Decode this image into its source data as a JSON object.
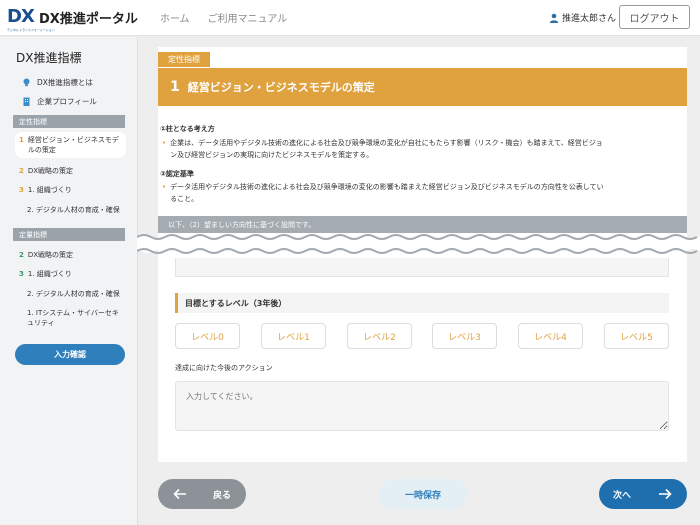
{
  "header": {
    "logo_mark": "DX",
    "logo_sub": "デジタルトランスフォーメーション",
    "app_title": "DX推進ポータル",
    "nav": [
      "ホーム",
      "ご利用マニュアル"
    ],
    "user_name": "推進太郎さん",
    "logout_label": "ログアウト"
  },
  "sidebar": {
    "title": "DX推進指標",
    "links": [
      {
        "icon": "lightbulb-icon",
        "label": "DX推進指標とは"
      },
      {
        "icon": "building-icon",
        "label": "企業プロフィール"
      }
    ],
    "qualitative": {
      "section_label": "定性指標",
      "items": [
        {
          "num": "1",
          "label": "経営ビジョン・ビジネスモデルの策定",
          "line1": "経営ビジョン・ビジネスモデ",
          "line2": "ルの策定",
          "active": true
        },
        {
          "num": "2",
          "label": "DX戦略の策定"
        },
        {
          "num": "3",
          "label": "1. 組織づくり"
        }
      ],
      "subs": [
        "2. デジタル人材の育成・確保"
      ]
    },
    "quantitative": {
      "section_label": "定量指標",
      "items": [
        {
          "num": "2",
          "label": "DX戦略の策定"
        },
        {
          "num": "3",
          "label": "1. 組織づくり"
        }
      ],
      "subs": [
        "2. デジタル人材の育成・確保",
        "1. ITシステム・サイバーセキ",
        "ュリティ"
      ]
    },
    "confirm_label": "入力確認"
  },
  "main": {
    "badge": "定性指標",
    "banner_num": "1",
    "banner_title": "経営ビジョン・ビジネスモデルの策定",
    "basic_heading": "①柱となる考え方",
    "basic_text_1": "企業は、データ活用やデジタル技術の進化による社会及び競争環境の変化が自社にもたらす影響（リスク・機会）も踏まえて、経営ビジョ",
    "basic_text_2": "ン及び経営ビジョンの実現に向けたビジネスモデルを策定する。",
    "cert_heading": "②認定基準",
    "cert_text_1": "データ活用やデジタル技術の進化による社会及び競争環境の変化の影響も踏まえた経営ビジョン及びビジネスモデルの方向性を公表してい",
    "cert_text_2": "ること。",
    "question_bar": "以下、（2）望ましい方向性に基づく設問です。",
    "level_title": "目標とするレベル（3年後）",
    "levels": [
      "レベル0",
      "レベル1",
      "レベル2",
      "レベル3",
      "レベル4",
      "レベル5"
    ],
    "action_label": "達成に向けた今後のアクション",
    "action_placeholder": "入力してください。"
  },
  "footer": {
    "back_label": "戻る",
    "save_label": "一時保存",
    "next_label": "次へ"
  },
  "colors": {
    "accent": "#e0a23f",
    "primary": "#1f6fae",
    "sidebar_bg": "#f2f3f5",
    "section_gray": "#9aa3aa"
  }
}
